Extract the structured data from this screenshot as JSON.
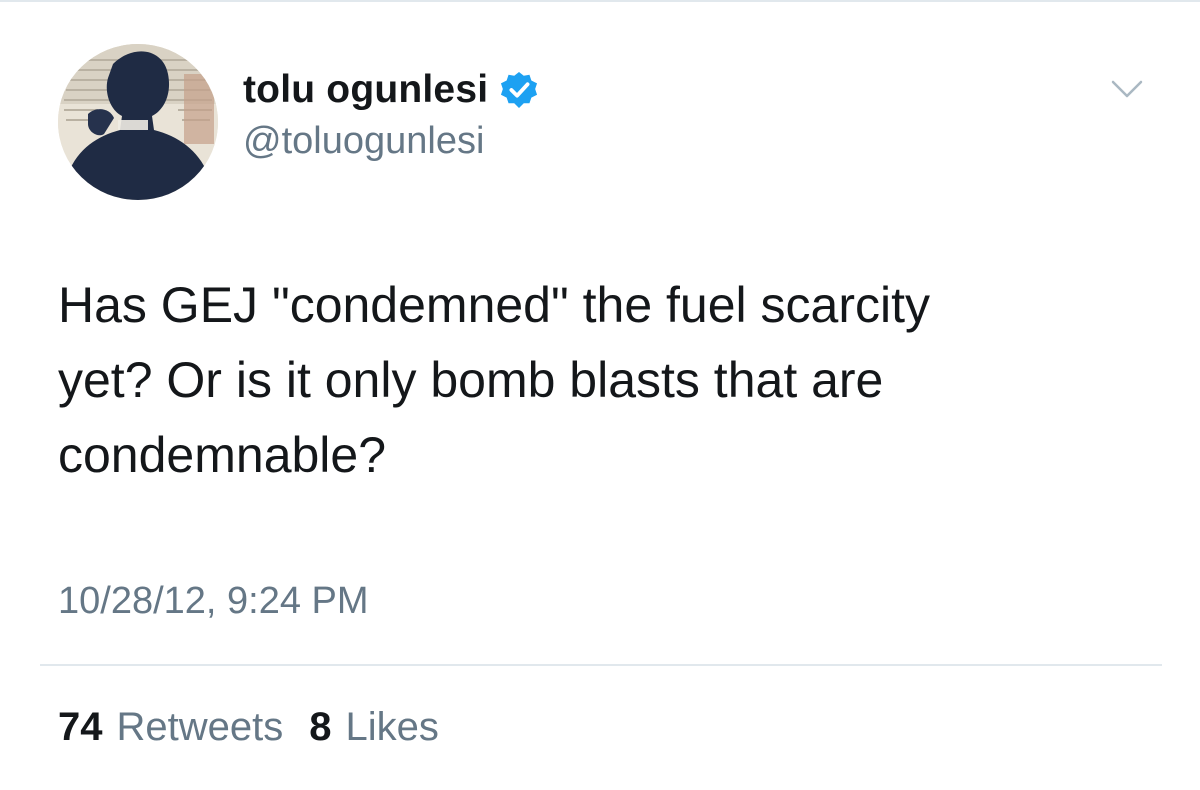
{
  "user": {
    "display_name": "tolu ogunlesi",
    "handle": "@toluogunlesi",
    "verified": true
  },
  "tweet": {
    "text_lines": [
      "Has GEJ \"condemned\" the fuel scarcity",
      "yet? Or is it only bomb blasts that are",
      "condemnable?"
    ],
    "timestamp": "10/28/12, 9:24 PM"
  },
  "stats": {
    "retweets_count": "74",
    "retweets_label": "Retweets",
    "likes_count": "8",
    "likes_label": "Likes"
  },
  "icons": {
    "verified": "verified-badge-icon",
    "menu": "chevron-down-icon"
  },
  "colors": {
    "text_primary": "#14171a",
    "text_secondary": "#657786",
    "verified_blue": "#1da1f2",
    "divider": "#e1e8ed",
    "background": "#ffffff"
  }
}
